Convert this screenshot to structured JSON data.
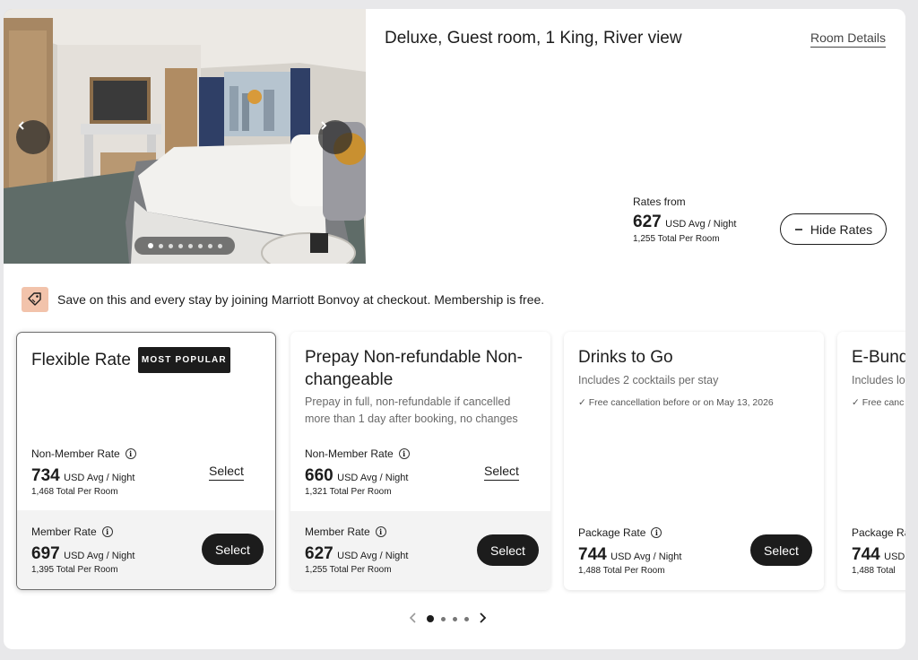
{
  "room": {
    "title": "Deluxe, Guest room, 1 King, River view",
    "details_link": "Room Details",
    "rates_from_label": "Rates from",
    "rates_from_price": "627",
    "rates_from_unit": "USD Avg / Night",
    "rates_from_total": "1,255 Total Per Room",
    "hide_rates_label": "Hide Rates",
    "hide_rates_icon": "minus-icon",
    "gallery": {
      "photo_count": 8,
      "current_photo": 1,
      "prev_icon": "chevron-left-icon",
      "next_icon": "chevron-right-icon"
    }
  },
  "promo": {
    "icon": "tag-icon",
    "text": "Save on this and every stay by joining Marriott Bonvoy at checkout. Membership is free."
  },
  "rates": [
    {
      "name": "Flexible Rate",
      "badge": "MOST POPULAR",
      "non_member": {
        "label": "Non-Member Rate",
        "price": "734",
        "unit": "USD Avg / Night",
        "total": "1,468 Total Per Room",
        "action": "Select"
      },
      "member": {
        "label": "Member Rate",
        "price": "697",
        "unit": "USD Avg / Night",
        "total": "1,395 Total Per Room",
        "action": "Select"
      }
    },
    {
      "name": "Prepay Non-refundable Non-changeable",
      "description": "Prepay in full, non-refundable if cancelled more than 1 day after booking, no changes",
      "non_member": {
        "label": "Non-Member Rate",
        "price": "660",
        "unit": "USD Avg / Night",
        "total": "1,321 Total Per Room",
        "action": "Select"
      },
      "member": {
        "label": "Member Rate",
        "price": "627",
        "unit": "USD Avg / Night",
        "total": "1,255 Total Per Room",
        "action": "Select"
      }
    },
    {
      "name": "Drinks to Go",
      "description": "Includes 2 cocktails per stay",
      "cancellation": "✓  Free cancellation before or on May 13, 2026",
      "package": {
        "label": "Package Rate",
        "price": "744",
        "unit": "USD Avg / Night",
        "total": "1,488 Total Per Room",
        "action": "Select"
      }
    },
    {
      "name": "E-Bund",
      "description": "Includes lo",
      "cancellation": "✓  Free canc",
      "package": {
        "label": "Package Rate",
        "price": "744",
        "unit": "USD",
        "total": "1,488 Total"
      }
    }
  ],
  "pager": {
    "pages": 4,
    "current": 1,
    "prev_icon": "chevron-left-icon",
    "next_icon": "chevron-right-icon"
  },
  "colors": {
    "text": "#1c1c1c",
    "promo_tag_bg": "#f2c3ab",
    "button_bg": "#1c1c1c",
    "member_band_bg": "#f3f3f3"
  }
}
